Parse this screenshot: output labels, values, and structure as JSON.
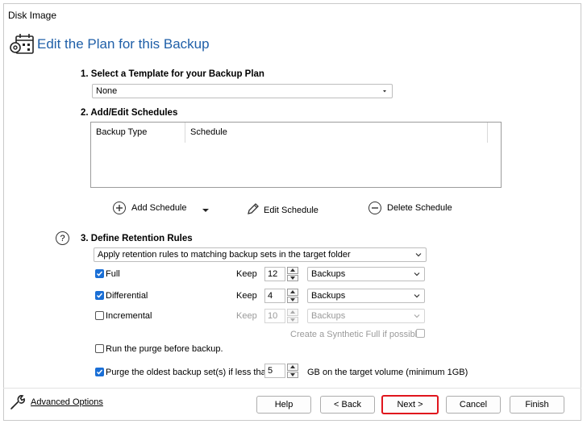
{
  "window": {
    "title": "Disk Image"
  },
  "header": {
    "title": "Edit the Plan for this Backup",
    "icon": "calendar-gear-icon"
  },
  "template": {
    "label": "1. Select a Template for your Backup Plan",
    "value": "None"
  },
  "schedules": {
    "label": "2. Add/Edit Schedules",
    "columns": [
      "Backup Type",
      "Schedule"
    ],
    "add_label": "Add Schedule",
    "edit_label": "Edit Schedule",
    "delete_label": "Delete Schedule"
  },
  "retention": {
    "label": "3. Define Retention Rules",
    "mode": "Apply retention rules to matching backup sets in the target folder",
    "keep_label": "Keep",
    "rows": [
      {
        "name": "Full",
        "checked": true,
        "enabled": true,
        "keep": "12",
        "unit": "Backups"
      },
      {
        "name": "Differential",
        "checked": true,
        "enabled": true,
        "keep": "4",
        "unit": "Backups"
      },
      {
        "name": "Incremental",
        "checked": false,
        "enabled": true,
        "keep": "10",
        "unit": "Backups"
      }
    ],
    "synthetic_label": "Create a Synthetic Full if possible",
    "purge_before_label": "Run the purge before backup.",
    "purge_oldest_label": "Purge the oldest backup set(s) if less than",
    "purge_oldest_value": "5",
    "purge_oldest_suffix": "GB on the target volume (minimum 1GB)"
  },
  "footer": {
    "advanced_label": "Advanced Options",
    "help": "Help",
    "back": "< Back",
    "next": "Next >",
    "cancel": "Cancel",
    "finish": "Finish"
  },
  "colors": {
    "accent": "#1f5fa8",
    "check": "#1a6fd6",
    "highlight": "#e0151d"
  }
}
